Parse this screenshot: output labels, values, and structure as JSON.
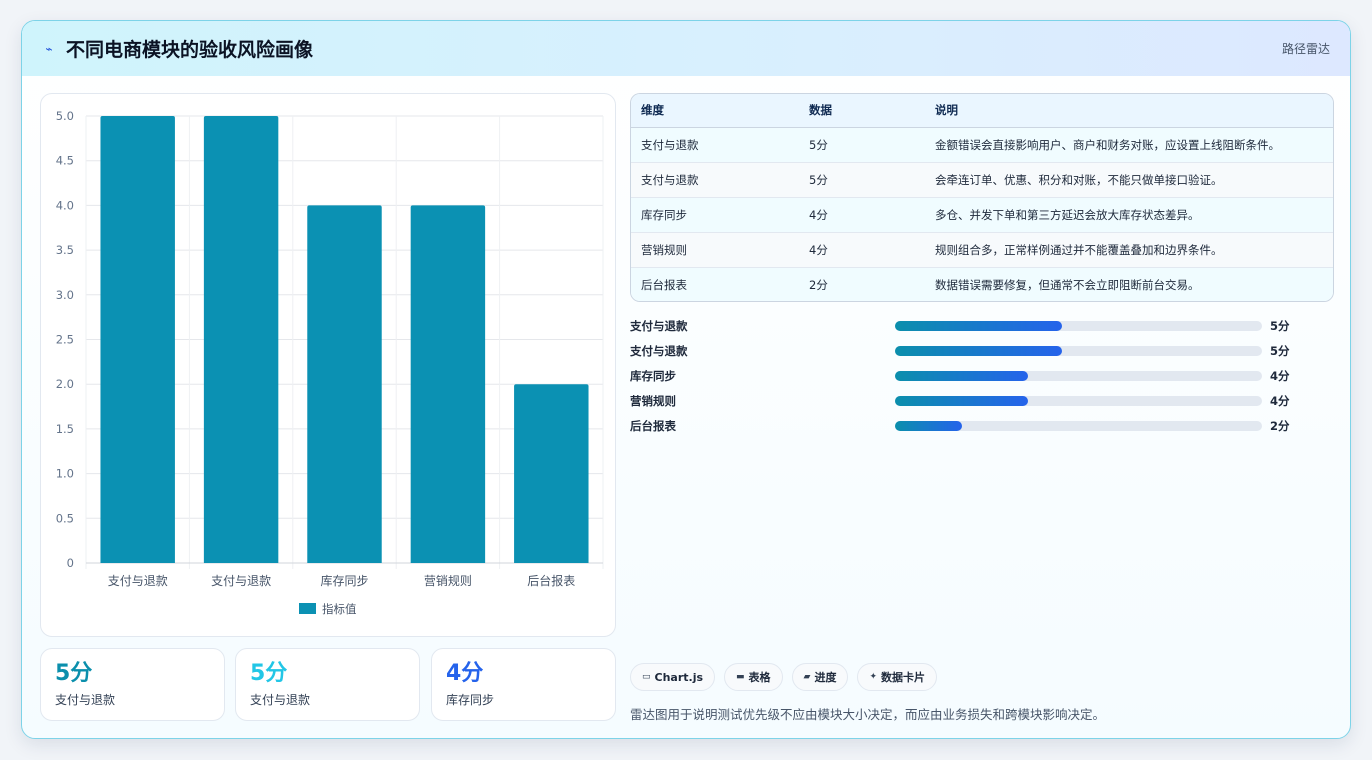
{
  "header": {
    "icon": "lightning-icon",
    "title": "不同电商模块的验收风险画像",
    "right_label": "路径雷达"
  },
  "chart_data": {
    "type": "bar",
    "categories": [
      "支付与退款",
      "支付与退款",
      "库存同步",
      "营销规则",
      "后台报表"
    ],
    "series": [
      {
        "name": "指标值",
        "values": [
          5,
          5,
          4,
          4,
          2
        ],
        "color": "#0b91b3"
      }
    ],
    "ylim": [
      0,
      5
    ],
    "yticks": [
      "5.0",
      "4.5",
      "4.0",
      "3.5",
      "3.0",
      "2.5",
      "2.0",
      "1.5",
      "1.0",
      "0.5",
      "0"
    ],
    "legend_position": "bottom",
    "grid": true
  },
  "stats": [
    {
      "value": "5分",
      "label": "支付与退款",
      "color": "#0b8fac"
    },
    {
      "value": "5分",
      "label": "支付与退款",
      "color": "#22c6e6"
    },
    {
      "value": "4分",
      "label": "库存同步",
      "color": "#2563eb"
    }
  ],
  "table": {
    "headers": [
      "维度",
      "数据",
      "说明"
    ],
    "rows": [
      [
        "支付与退款",
        "5分",
        "金额错误会直接影响用户、商户和财务对账，应设置上线阻断条件。"
      ],
      [
        "支付与退款",
        "5分",
        "会牵连订单、优惠、积分和对账，不能只做单接口验证。"
      ],
      [
        "库存同步",
        "4分",
        "多仓、并发下单和第三方延迟会放大库存状态差异。"
      ],
      [
        "营销规则",
        "4分",
        "规则组合多，正常样例通过并不能覆盖叠加和边界条件。"
      ],
      [
        "后台报表",
        "2分",
        "数据错误需要修复，但通常不会立即阻断前台交易。"
      ]
    ]
  },
  "progress": [
    {
      "label": "支付与退款",
      "value": "5分",
      "fraction": 0.4545
    },
    {
      "label": "支付与退款",
      "value": "5分",
      "fraction": 0.4545
    },
    {
      "label": "库存同步",
      "value": "4分",
      "fraction": 0.3636
    },
    {
      "label": "营销规则",
      "value": "4分",
      "fraction": 0.3636
    },
    {
      "label": "后台报表",
      "value": "2分",
      "fraction": 0.1818
    }
  ],
  "chips": [
    {
      "icon": "window-icon",
      "glyph": "▭",
      "label": "Chart.js"
    },
    {
      "icon": "table-icon",
      "glyph": "▬",
      "label": "表格"
    },
    {
      "icon": "folder-icon",
      "glyph": "▰",
      "label": "进度"
    },
    {
      "icon": "sparkle-icon",
      "glyph": "✦",
      "label": "数据卡片"
    }
  ],
  "note": "雷达图用于说明测试优先级不应由模块大小决定，而应由业务损失和跨模块影响决定。"
}
